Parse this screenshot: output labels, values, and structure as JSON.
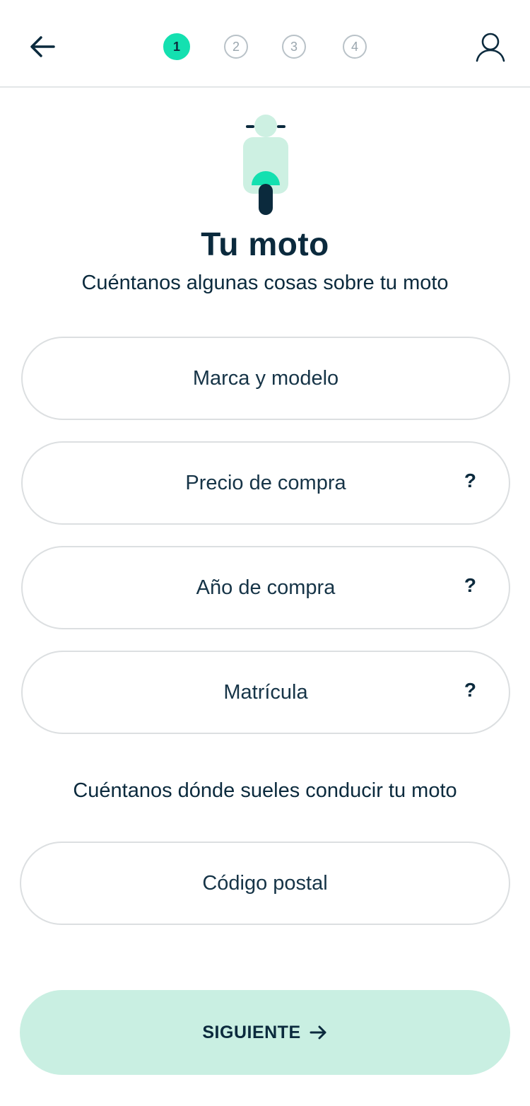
{
  "header": {
    "back_icon": "arrow-left-icon",
    "user_icon": "user-icon",
    "steps": [
      "1",
      "2",
      "3",
      "4"
    ],
    "active_step": 1
  },
  "hero": {
    "illustration_icon": "scooter-icon",
    "title": "Tu moto",
    "subtitle": "Cuéntanos algunas cosas sobre tu moto"
  },
  "fields": {
    "brand_model": {
      "placeholder": "Marca y modelo"
    },
    "purchase_price": {
      "placeholder": "Precio de compra",
      "help": "?"
    },
    "purchase_year": {
      "placeholder": "Año de compra",
      "help": "?"
    },
    "plate": {
      "placeholder": "Matrícula",
      "help": "?"
    }
  },
  "location": {
    "label": "Cuéntanos dónde sueles conducir tu moto",
    "postal_code": {
      "placeholder": "Código postal"
    }
  },
  "actions": {
    "next_label": "SIGUIENTE"
  },
  "colors": {
    "primary_text": "#0b2a3d",
    "accent": "#14e0b0",
    "button_bg": "#c9efe2",
    "scooter_body": "#cdf0e2"
  }
}
